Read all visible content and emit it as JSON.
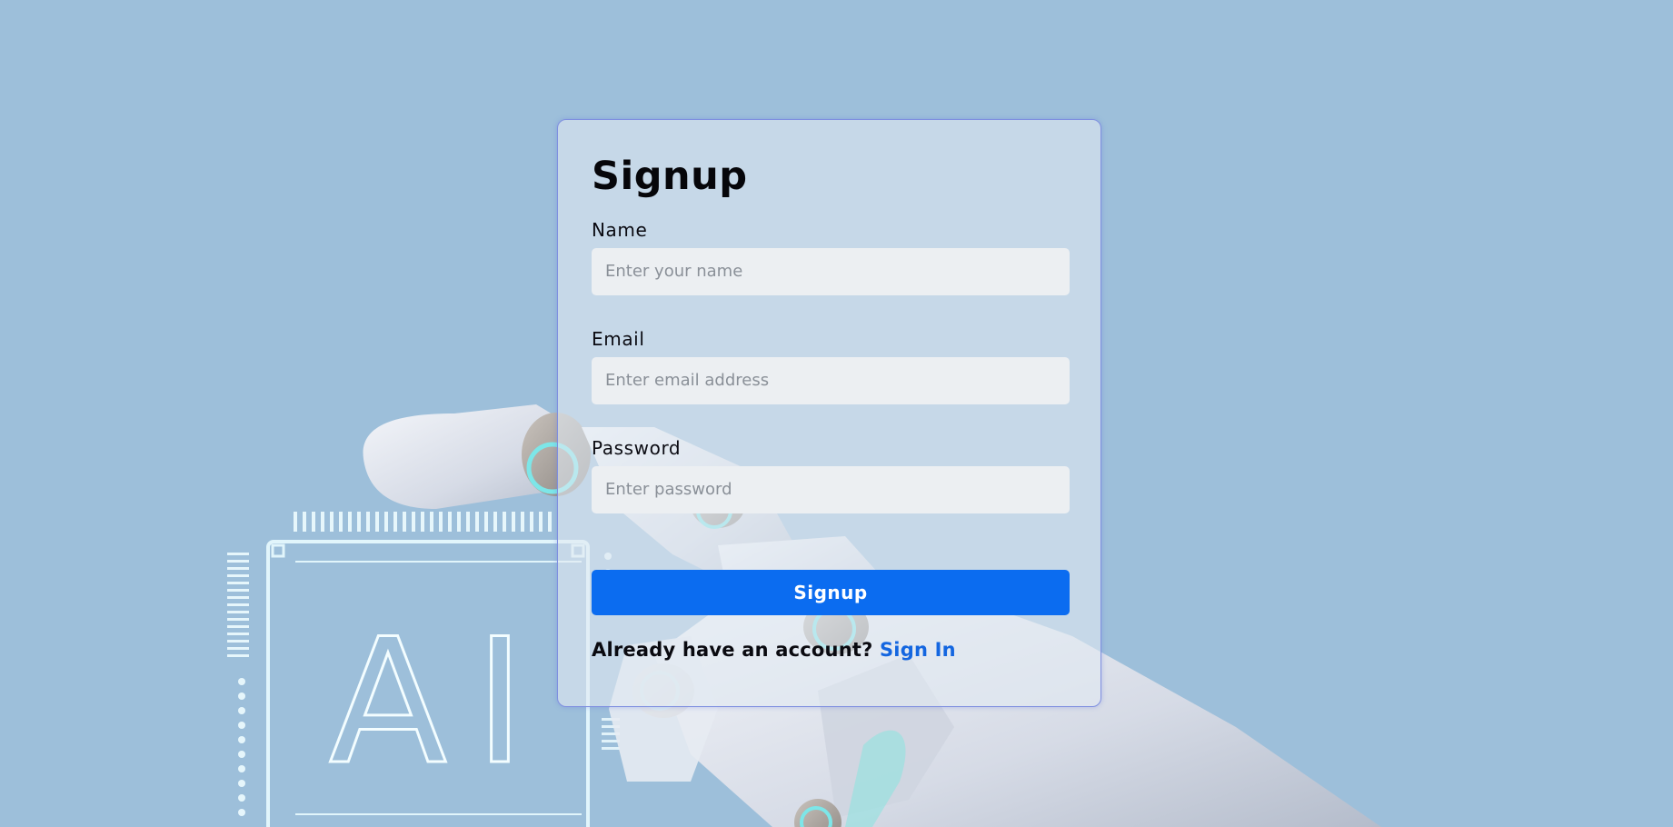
{
  "form": {
    "title": "Signup",
    "fields": [
      {
        "label": "Name",
        "placeholder": "Enter your name",
        "value": ""
      },
      {
        "label": "Email",
        "placeholder": "Enter email address",
        "value": ""
      },
      {
        "label": "Password",
        "placeholder": "Enter password",
        "value": ""
      }
    ],
    "submit_label": "Signup",
    "footer_text": "Already have an account?",
    "signin_link": "Sign In"
  },
  "background": {
    "chip_text": "AI"
  },
  "colors": {
    "page_background": "#9dbfda",
    "accent": "#0b6cf0",
    "link": "#1466e0",
    "card_border": "#7f8fe0",
    "input_background": "#eceff2"
  }
}
